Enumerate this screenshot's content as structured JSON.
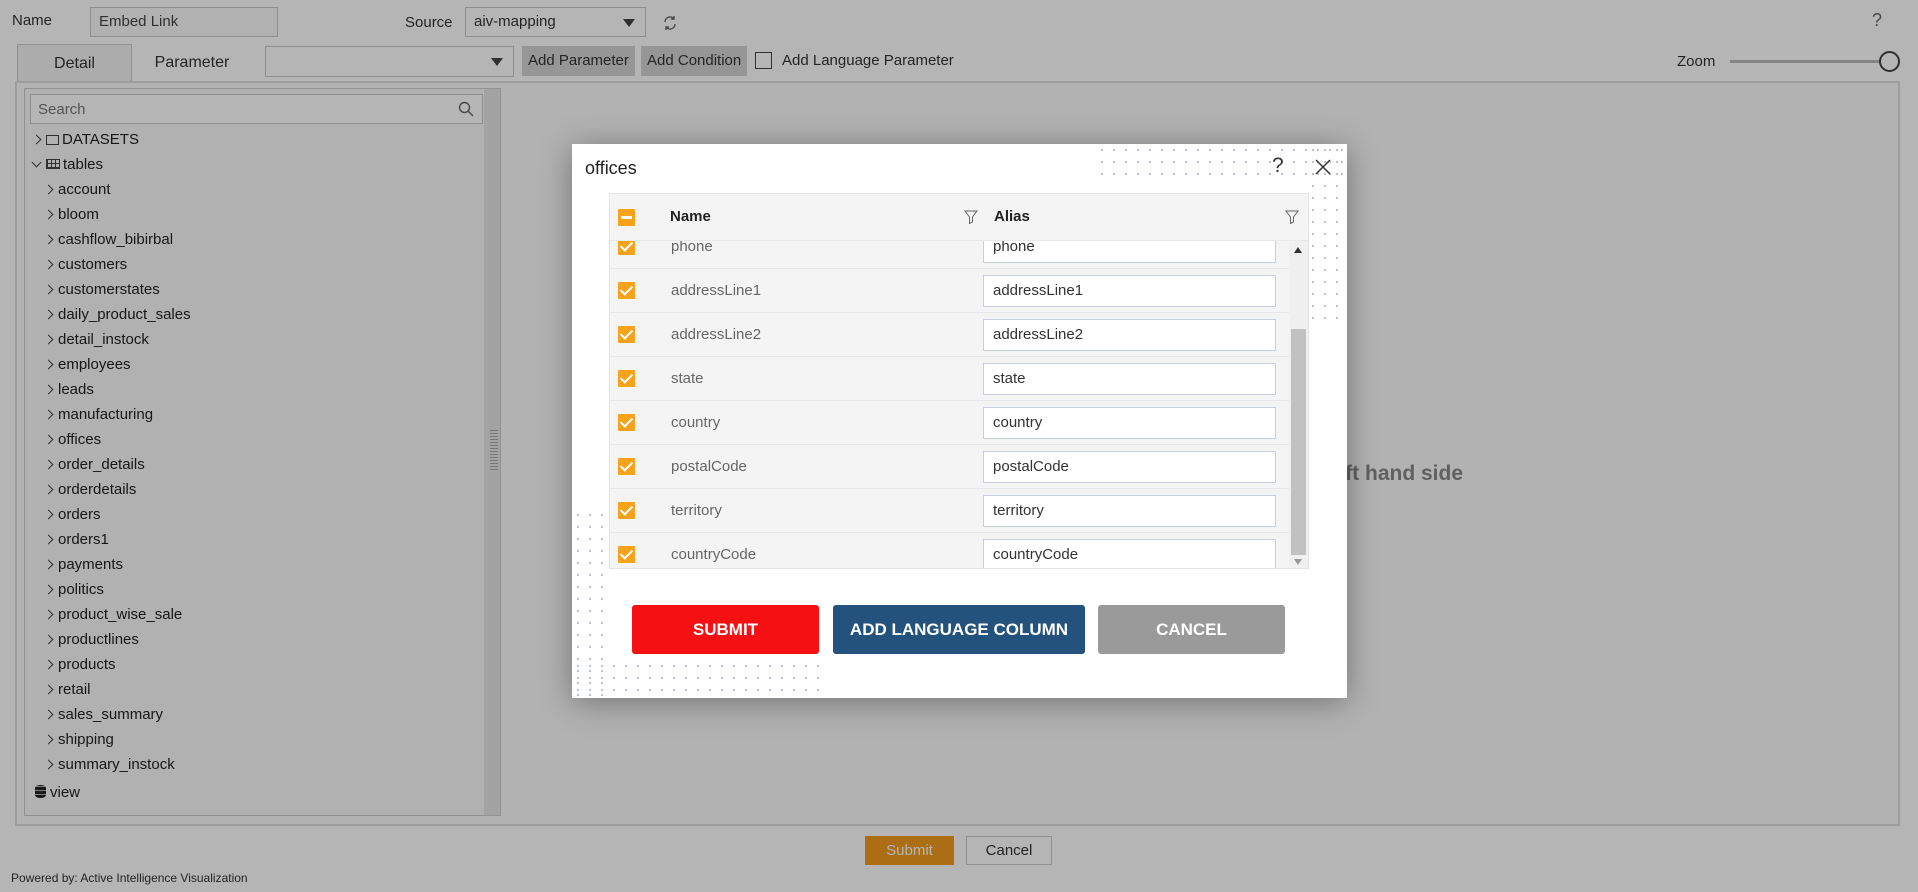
{
  "header": {
    "name_label": "Name",
    "name_value": "Embed Link",
    "source_label": "Source",
    "source_value": "aiv-mapping",
    "help": "?"
  },
  "tabs": [
    {
      "label": "Detail",
      "active": true
    },
    {
      "label": "Parameter"
    }
  ],
  "toolbar": {
    "parameter_select": "",
    "add_parameter": "Add Parameter",
    "add_condition": "Add Condition",
    "add_language_parameter": "Add Language Parameter",
    "language_checked": false,
    "zoom_label": "Zoom",
    "zoom_level": 1.0
  },
  "tree": {
    "search_placeholder": "Search",
    "datasets": "DATASETS",
    "tables": "tables",
    "table_items": [
      "account",
      "bloom",
      "cashflow_bibirbal",
      "customers",
      "customerstates",
      "daily_product_sales",
      "detail_instock",
      "employees",
      "leads",
      "manufacturing",
      "offices",
      "order_details",
      "orderdetails",
      "orders",
      "orders1",
      "payments",
      "politics",
      "product_wise_sale",
      "productlines",
      "products",
      "retail",
      "sales_summary",
      "shipping",
      "summary_instock"
    ],
    "view": "view"
  },
  "main_message": "n left hand side",
  "footer": {
    "submit": "Submit",
    "cancel": "Cancel",
    "powered_by": "Powered by: Active Intelligence Visualization"
  },
  "colors": {
    "accent": "#f29b1d",
    "modal_submit": "#f51014",
    "modal_lang": "#23527c",
    "modal_cancel": "#9a9a9a",
    "checkbox": "#f7a21b"
  },
  "modal": {
    "title": "offices",
    "help": "?",
    "columns": {
      "name": "Name",
      "alias": "Alias"
    },
    "rows": [
      {
        "name": "phone",
        "alias": "phone",
        "checked": true
      },
      {
        "name": "addressLine1",
        "alias": "addressLine1",
        "checked": true
      },
      {
        "name": "addressLine2",
        "alias": "addressLine2",
        "checked": true
      },
      {
        "name": "state",
        "alias": "state",
        "checked": true
      },
      {
        "name": "country",
        "alias": "country",
        "checked": true
      },
      {
        "name": "postalCode",
        "alias": "postalCode",
        "checked": true
      },
      {
        "name": "territory",
        "alias": "territory",
        "checked": true
      },
      {
        "name": "countryCode",
        "alias": "countryCode",
        "checked": true
      }
    ],
    "submit": "SUBMIT",
    "add_language_column": "ADD LANGUAGE COLUMN",
    "cancel": "CANCEL"
  }
}
